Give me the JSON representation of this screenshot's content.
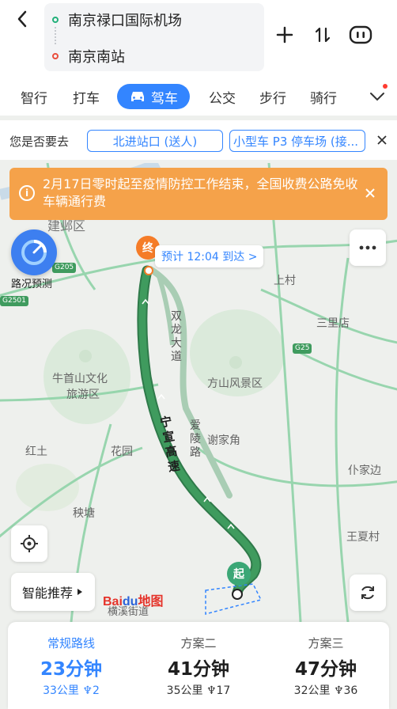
{
  "route": {
    "origin": "南京禄口国际机场",
    "destination": "南京南站"
  },
  "modes": [
    "智行",
    "打车",
    "驾车",
    "公交",
    "步行",
    "骑行"
  ],
  "active_mode": "驾车",
  "suggestion": {
    "label": "您是否要去",
    "chips": [
      "北进站口 (送人)",
      "小型车 P3 停车场 (接..."
    ]
  },
  "notice": {
    "text": "2月17日零时起至疫情防控工作结束，全国收费公路免收车辆通行费"
  },
  "map": {
    "traffic_label": "路况预测",
    "eta": "预计 12:04 到达 >",
    "end_pin": "终",
    "start_pin": "起",
    "smart_recommend": "智能推荐",
    "logo_left": "Bai",
    "logo_mid": "du",
    "logo_right": "地图",
    "places": {
      "jianye": "建邺区",
      "shangcun": "上村",
      "sanlidian": "三里店",
      "niushou": "牛首山文化",
      "lvyou": "旅游区",
      "fangshan": "方山风景区",
      "xiejiajiao": "谢家角",
      "hongtu": "红土",
      "huayuan": "花园",
      "yangtang": "秧塘",
      "pujiabian": "仆家边",
      "wangxiacun": "王夏村",
      "hengxi": "横溪街道"
    },
    "roads": {
      "ningxuan": [
        "宁",
        "宣",
        "高",
        "速"
      ],
      "shuanglong": [
        "双",
        "龙",
        "大",
        "道"
      ],
      "ailing": [
        "爱",
        "陵",
        "路"
      ]
    },
    "shields": {
      "g205": "G205",
      "g2501": "G2501",
      "g25": "G25"
    }
  },
  "routes": [
    {
      "label": "常规路线",
      "time": "23分钟",
      "distance": "33公里",
      "lights": "2"
    },
    {
      "label": "方案二",
      "time": "41分钟",
      "distance": "35公里",
      "lights": "17"
    },
    {
      "label": "方案三",
      "time": "47分钟",
      "distance": "32公里",
      "lights": "36"
    }
  ],
  "colors": {
    "accent": "#3385ff",
    "route_main": "#3f9b5e",
    "route_alt": "#a9cdb4",
    "notice": "#f5a24a",
    "end_pin": "#f57c28"
  }
}
